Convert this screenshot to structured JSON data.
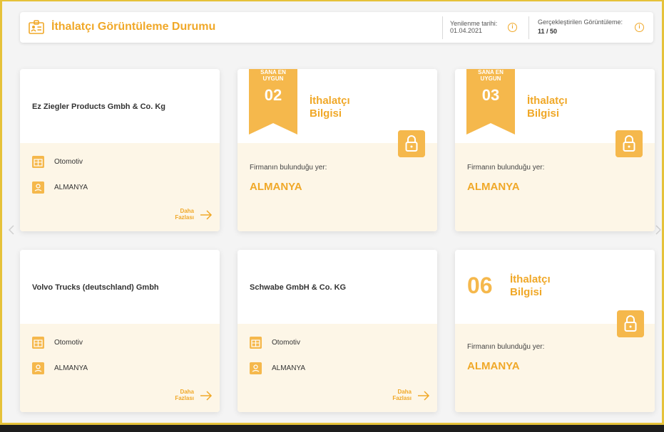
{
  "header": {
    "title": "İthalatçı Görüntüleme Durumu",
    "refresh_label": "Yenilenme tarihi:",
    "refresh_date": "01.04.2021",
    "views_label": "Gerçekleştirilen Görüntüleme:",
    "views_value": "11 / 50",
    "icon": "id-card-icon",
    "info_icon": "info-icon"
  },
  "colors": {
    "accent": "#f0a828",
    "accent_light": "#f5b84c",
    "card_bottom": "#fdf6e7",
    "frame_border": "#e6c23a"
  },
  "cards": [
    {
      "type": "company",
      "name": "Ez Ziegler Products Gmbh & Co. Kg",
      "sector": "Otomotiv",
      "country": "ALMANYA",
      "more_line1": "Daha",
      "more_line2": "Fazlası"
    },
    {
      "type": "locked",
      "ribbon_line1": "SANA EN",
      "ribbon_line2": "UYGUN",
      "number": "02",
      "title_line1": "İthalatçı",
      "title_line2": "Bilgisi",
      "location_label": "Firmanın bulunduğu yer:",
      "location_value": "ALMANYA"
    },
    {
      "type": "locked",
      "ribbon_line1": "SANA EN",
      "ribbon_line2": "UYGUN",
      "number": "03",
      "title_line1": "İthalatçı",
      "title_line2": "Bilgisi",
      "location_label": "Firmanın bulunduğu yer:",
      "location_value": "ALMANYA"
    },
    {
      "type": "company",
      "name": "Volvo Trucks (deutschland) Gmbh",
      "sector": "Otomotiv",
      "country": "ALMANYA",
      "more_line1": "Daha",
      "more_line2": "Fazlası"
    },
    {
      "type": "company",
      "name": "Schwabe GmbH & Co. KG",
      "sector": "Otomotiv",
      "country": "ALMANYA",
      "more_line1": "Daha",
      "more_line2": "Fazlası"
    },
    {
      "type": "locked-plain",
      "number": "06",
      "title_line1": "İthalatçı",
      "title_line2": "Bilgisi",
      "location_label": "Firmanın bulunduğu yer:",
      "location_value": "ALMANYA"
    }
  ]
}
